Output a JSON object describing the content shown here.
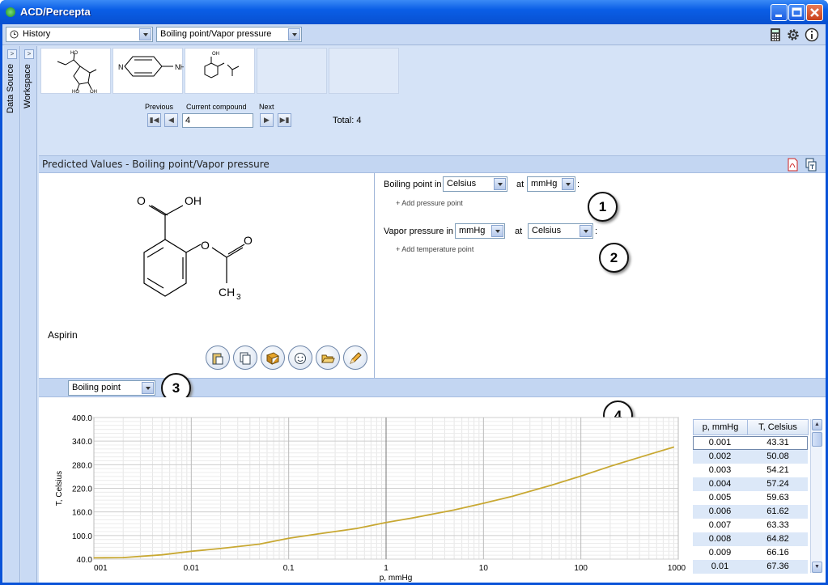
{
  "window": {
    "title": "ACD/Percepta",
    "icon": "percepta-app-icon"
  },
  "toolbar": {
    "history_label": "History",
    "module_label": "Boiling point/Vapor pressure",
    "icons": [
      "calculator-icon",
      "gear-icon",
      "info-icon"
    ]
  },
  "sidetabs": {
    "data_source": "Data Source",
    "workspace": "Workspace"
  },
  "navigator": {
    "previous_label": "Previous",
    "current_label": "Current compound",
    "next_label": "Next",
    "current_value": "4",
    "total_text": "Total: 4",
    "thumb_labels": [
      "HO",
      "N",
      "NH",
      "OH",
      "HO",
      "HO",
      "OH"
    ]
  },
  "section": {
    "title": "Predicted Values - Boiling point/Vapor pressure"
  },
  "molecule": {
    "name": "Aspirin",
    "labels": {
      "o": "O",
      "oh": "OH",
      "ch": "CH",
      "sub": "3"
    }
  },
  "properties": {
    "bp_label": "Boiling point in",
    "bp_unit": "Celsius",
    "at_label": "at",
    "bp_pressure_unit": "mmHg",
    "colon": ":",
    "add_pressure": "+ Add pressure point",
    "vp_label": "Vapor pressure in",
    "vp_unit": "mmHg",
    "vp_temp_unit": "Celsius",
    "add_temperature": "+ Add temperature point"
  },
  "callouts": [
    "1",
    "2",
    "3",
    "4"
  ],
  "plot_selector": "Boiling point",
  "chart_data": {
    "type": "line",
    "xlabel": "p, mmHg",
    "ylabel": "T, Celsius",
    "x_scale": "log",
    "xlim": [
      0.001,
      1000
    ],
    "ylim": [
      40,
      400
    ],
    "xticks": [
      "001",
      "0.01",
      "0.1",
      "1",
      "10",
      "100",
      "1000"
    ],
    "yticks": [
      "400.0",
      "340.0",
      "280.0",
      "220.0",
      "160.0",
      "100.0",
      "40.0"
    ],
    "grid": true,
    "line_color": "#c8a832",
    "x": [
      0.001,
      0.002,
      0.005,
      0.01,
      0.02,
      0.05,
      0.1,
      0.2,
      0.5,
      1,
      2,
      5,
      10,
      20,
      50,
      100,
      200,
      500,
      900
    ],
    "y": [
      43.31,
      44,
      51,
      60,
      67,
      78,
      93,
      104,
      118,
      133,
      146,
      165,
      182,
      200,
      228,
      251,
      276,
      306,
      325
    ]
  },
  "table": {
    "col1": "p, mmHg",
    "col2": "T, Celsius",
    "rows": [
      [
        "0.001",
        "43.31"
      ],
      [
        "0.002",
        "50.08"
      ],
      [
        "0.003",
        "54.21"
      ],
      [
        "0.004",
        "57.24"
      ],
      [
        "0.005",
        "59.63"
      ],
      [
        "0.006",
        "61.62"
      ],
      [
        "0.007",
        "63.33"
      ],
      [
        "0.008",
        "64.82"
      ],
      [
        "0.009",
        "66.16"
      ],
      [
        "0.01",
        "67.36"
      ]
    ]
  }
}
